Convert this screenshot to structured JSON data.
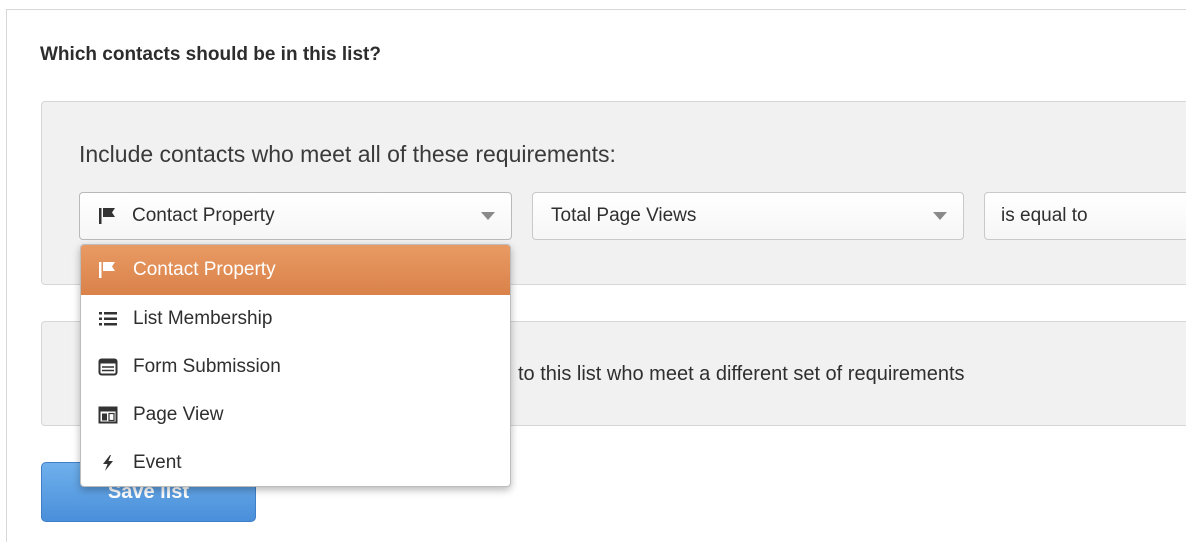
{
  "header": {
    "title": "Which contacts should be in this list?"
  },
  "requirements": {
    "label": "Include contacts who meet all of these requirements:",
    "filter_type": {
      "value": "Contact Property",
      "icon": "flag-icon"
    },
    "property": {
      "value": "Total Page Views"
    },
    "operator": {
      "value": "is equal to"
    }
  },
  "or_section": {
    "text": "to this list who meet a different set of requirements"
  },
  "actions": {
    "save_label": "Save list"
  },
  "dropdown": {
    "items": [
      {
        "label": "Contact Property",
        "icon": "flag-icon",
        "selected": true
      },
      {
        "label": "List Membership",
        "icon": "list-icon"
      },
      {
        "label": "Form Submission",
        "icon": "form-icon"
      },
      {
        "label": "Page View",
        "icon": "page-icon"
      },
      {
        "label": "Event",
        "icon": "bolt-icon"
      }
    ]
  },
  "colors": {
    "highlight": "#e0894f",
    "button": "#5b9de3",
    "panel": "#f1f1f1"
  }
}
